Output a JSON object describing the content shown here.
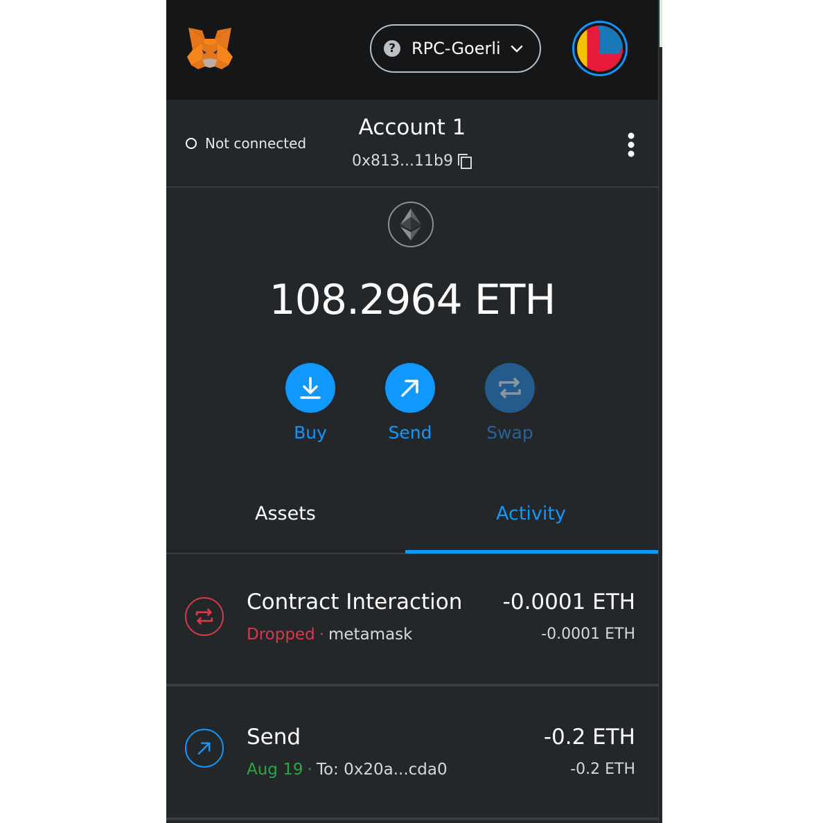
{
  "header": {
    "network_label": "RPC-Goerli",
    "network_unknown_glyph": "?"
  },
  "account": {
    "connection_status": "Not connected",
    "name": "Account 1",
    "address": "0x813...11b9"
  },
  "balance": {
    "text": "108.2964 ETH"
  },
  "actions": [
    {
      "label": "Buy",
      "enabled": true
    },
    {
      "label": "Send",
      "enabled": true
    },
    {
      "label": "Swap",
      "enabled": false
    }
  ],
  "tabs": [
    {
      "label": "Assets",
      "active": false
    },
    {
      "label": "Activity",
      "active": true
    }
  ],
  "transactions": [
    {
      "title": "Contract Interaction",
      "status": "Dropped",
      "separator": "·",
      "detail": "metamask",
      "amount": "-0.0001 ETH",
      "secondary_amount": "-0.0001 ETH",
      "icon": "swap-arrows-icon",
      "color": "#d73a49"
    },
    {
      "title": "Send",
      "status": "Aug 19",
      "separator": "·",
      "detail": "To: 0x20a...cda0",
      "amount": "-0.2 ETH",
      "secondary_amount": "-0.2 ETH",
      "icon": "send-arrow-icon",
      "color": "#1098fc"
    }
  ],
  "colors": {
    "accent": "#1098fc",
    "background": "#24272a",
    "header": "#141618",
    "error": "#d73a49",
    "success": "#28a745"
  }
}
